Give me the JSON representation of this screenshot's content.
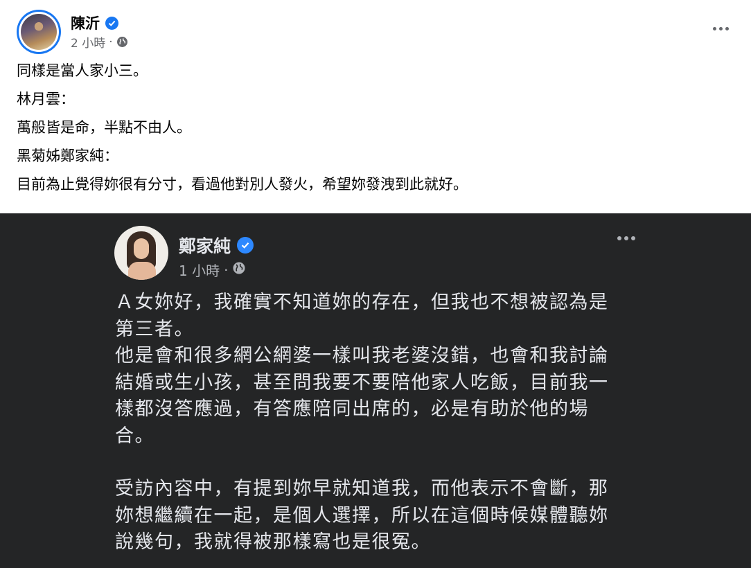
{
  "post": {
    "author": "陳沂",
    "time": "2 小時",
    "separator": "·",
    "lines": [
      "同樣是當人家小三。",
      "林月雲：",
      "萬般皆是命，半點不由人。",
      "黑菊姊鄭家純：",
      "目前為止覺得妳很有分寸，看過他對別人發火，希望妳發洩到此就好。"
    ]
  },
  "embedded_post": {
    "author": "鄭家純",
    "time": "1 小時",
    "separator": "·",
    "paragraphs": [
      "Ａ女妳好，我確實不知道妳的存在，但我也不想被認為是\n第三者。\n他是會和很多網公網婆一樣叫我老婆沒錯，也會和我討論\n結婚或生小孩，甚至問我要不要陪他家人吃飯，目前我一\n樣都沒答應過，有答應陪同出席的，必是有助於他的場\n合。",
      "受訪內容中，有提到妳早就知道我，而他表示不會斷，那\n妳想繼續在一起，是個人選擇，所以在這個時候媒體聽妳\n說幾句，我就得被那樣寫也是很冤。"
    ]
  },
  "icons": {
    "verified": "verified-badge-icon",
    "audience": "globe-icon",
    "more": "more-options-icon"
  },
  "colors": {
    "accent": "#1877f2",
    "dark_bg": "#242526",
    "dark_text": "#e4e6eb",
    "meta_text": "#65676b"
  }
}
